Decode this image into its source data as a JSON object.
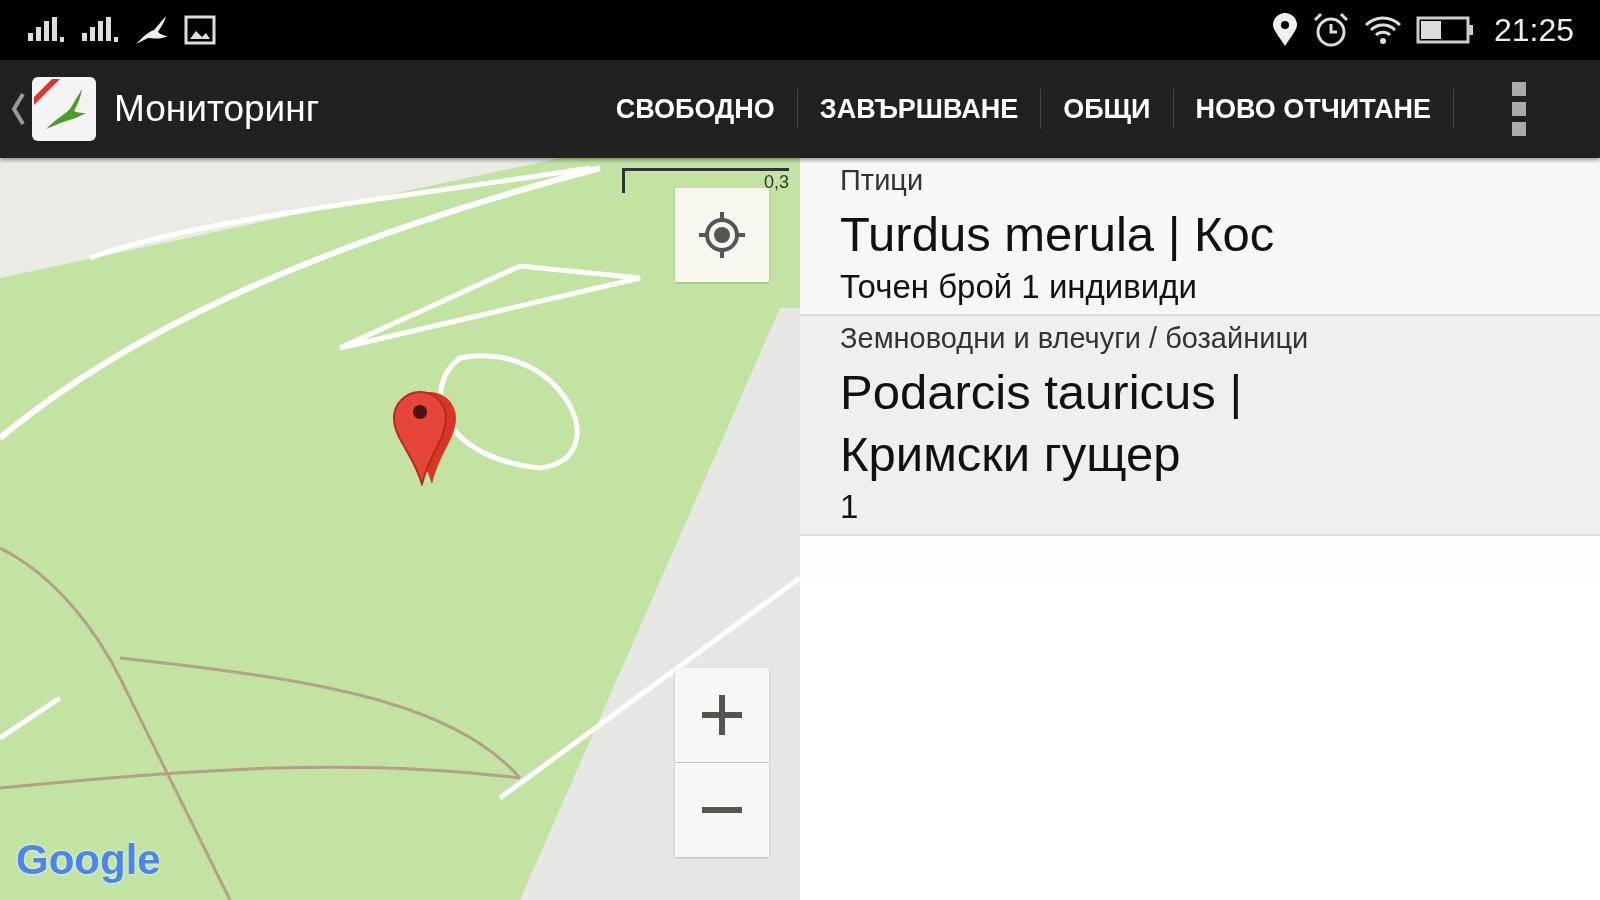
{
  "status_bar": {
    "time": "21:25"
  },
  "action_bar": {
    "title": "Мониторинг",
    "actions": [
      {
        "label": "СВОБОДНО"
      },
      {
        "label": "ЗАВЪРШВАНЕ"
      },
      {
        "label": "ОБЩИ"
      },
      {
        "label": "НОВО ОТЧИТАНЕ"
      }
    ]
  },
  "map": {
    "kind": "picture",
    "scale_label": "0,3",
    "attribution": "Google"
  },
  "records": [
    {
      "category": "Птици",
      "title": "Turdus merula | Кос",
      "detail": "Точен брой 1 индивиди"
    },
    {
      "category": "Земноводни и влечуги / бозайници",
      "title": "Podarcis tauricus | Кримски гущер",
      "detail": "1"
    }
  ]
}
